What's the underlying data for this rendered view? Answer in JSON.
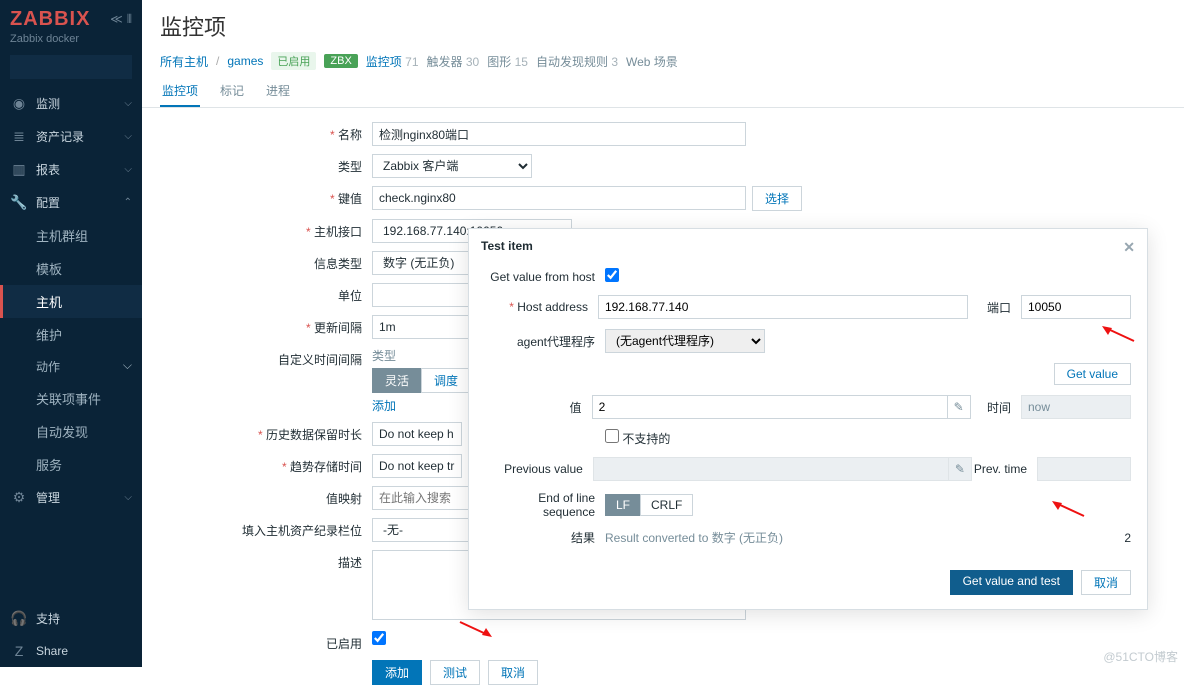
{
  "sidebar": {
    "logo": "ZABBIX",
    "subtitle": "Zabbix docker",
    "search_placeholder": "",
    "sections": [
      {
        "icon": "◉",
        "label": "监测",
        "expand": true
      },
      {
        "icon": "≣",
        "label": "资产记录",
        "expand": true
      },
      {
        "icon": "▥",
        "label": "报表",
        "expand": true
      },
      {
        "icon": "🔧",
        "label": "配置",
        "expand": true,
        "open": true,
        "subs": [
          {
            "label": "主机群组"
          },
          {
            "label": "模板"
          },
          {
            "label": "主机",
            "active": true
          },
          {
            "label": "维护"
          },
          {
            "label": "动作",
            "expand": true
          },
          {
            "label": "关联项事件"
          },
          {
            "label": "自动发现"
          },
          {
            "label": "服务"
          }
        ]
      },
      {
        "icon": "⚙",
        "label": "管理",
        "expand": true
      }
    ],
    "bottom": [
      {
        "icon": "🎧",
        "label": "支持"
      },
      {
        "icon": "Z",
        "label": "Share"
      }
    ]
  },
  "header": {
    "title": "监控项",
    "crumbs": {
      "all_hosts": "所有主机",
      "host": "games",
      "enabled": "已启用",
      "zbx": "ZBX",
      "items": {
        "label": "监控项",
        "count": "71"
      },
      "triggers": {
        "label": "触发器",
        "count": "30"
      },
      "graphs": {
        "label": "图形",
        "count": "15"
      },
      "discovery": {
        "label": "自动发现规则",
        "count": "3"
      },
      "web": {
        "label": "Web 场景"
      }
    },
    "subtabs": {
      "items": "监控项",
      "tags": "标记",
      "process": "进程"
    }
  },
  "form": {
    "name": {
      "label": "名称",
      "value": "检测nginx80端口"
    },
    "type": {
      "label": "类型",
      "value": "Zabbix 客户端"
    },
    "key": {
      "label": "键值",
      "value": "check.nginx80",
      "select_btn": "选择"
    },
    "iface": {
      "label": "主机接口",
      "value": "192.168.77.140:10050"
    },
    "info": {
      "label": "信息类型",
      "value": "数字 (无正负)"
    },
    "unit": {
      "label": "单位",
      "value": ""
    },
    "interval": {
      "label": "更新间隔",
      "value": "1m"
    },
    "custom": {
      "label": "自定义时间间隔",
      "type_lbl": "类型",
      "flex": "灵活",
      "sched": "调度",
      "add": "添加"
    },
    "history": {
      "label": "历史数据保留时长",
      "value": "Do not keep h"
    },
    "trends": {
      "label": "趋势存储时间",
      "value": "Do not keep tr"
    },
    "valmap": {
      "label": "值映射",
      "placeholder": "在此输入搜索"
    },
    "inventory": {
      "label": "填入主机资产纪录栏位",
      "value": "-无-"
    },
    "desc": {
      "label": "描述",
      "value": ""
    },
    "enabled": {
      "label": "已启用",
      "checked": true
    },
    "buttons": {
      "add": "添加",
      "test": "测试",
      "cancel": "取消"
    }
  },
  "dialog": {
    "title": "Test item",
    "get_from_host": {
      "label": "Get value from host",
      "checked": true
    },
    "host": {
      "label": "Host address",
      "value": "192.168.77.140",
      "port_label": "端口",
      "port_value": "10050"
    },
    "agent": {
      "label": "agent代理程序",
      "value": "(无agent代理程序)"
    },
    "get_value_btn": "Get value",
    "value": {
      "label": "值",
      "value": "2",
      "time_label": "时间",
      "time_value": "now"
    },
    "unsupported": "不支持的",
    "prev": {
      "label": "Previous value",
      "value": "",
      "pt_label": "Prev. time",
      "pt_value": ""
    },
    "eol": {
      "label": "End of line sequence",
      "lf": "LF",
      "crlf": "CRLF"
    },
    "result": {
      "label": "结果",
      "text": "Result converted to 数字 (无正负)",
      "num": "2"
    },
    "footer": {
      "gvt": "Get value and test",
      "cancel": "取消"
    }
  },
  "watermark": "@51CTO博客"
}
